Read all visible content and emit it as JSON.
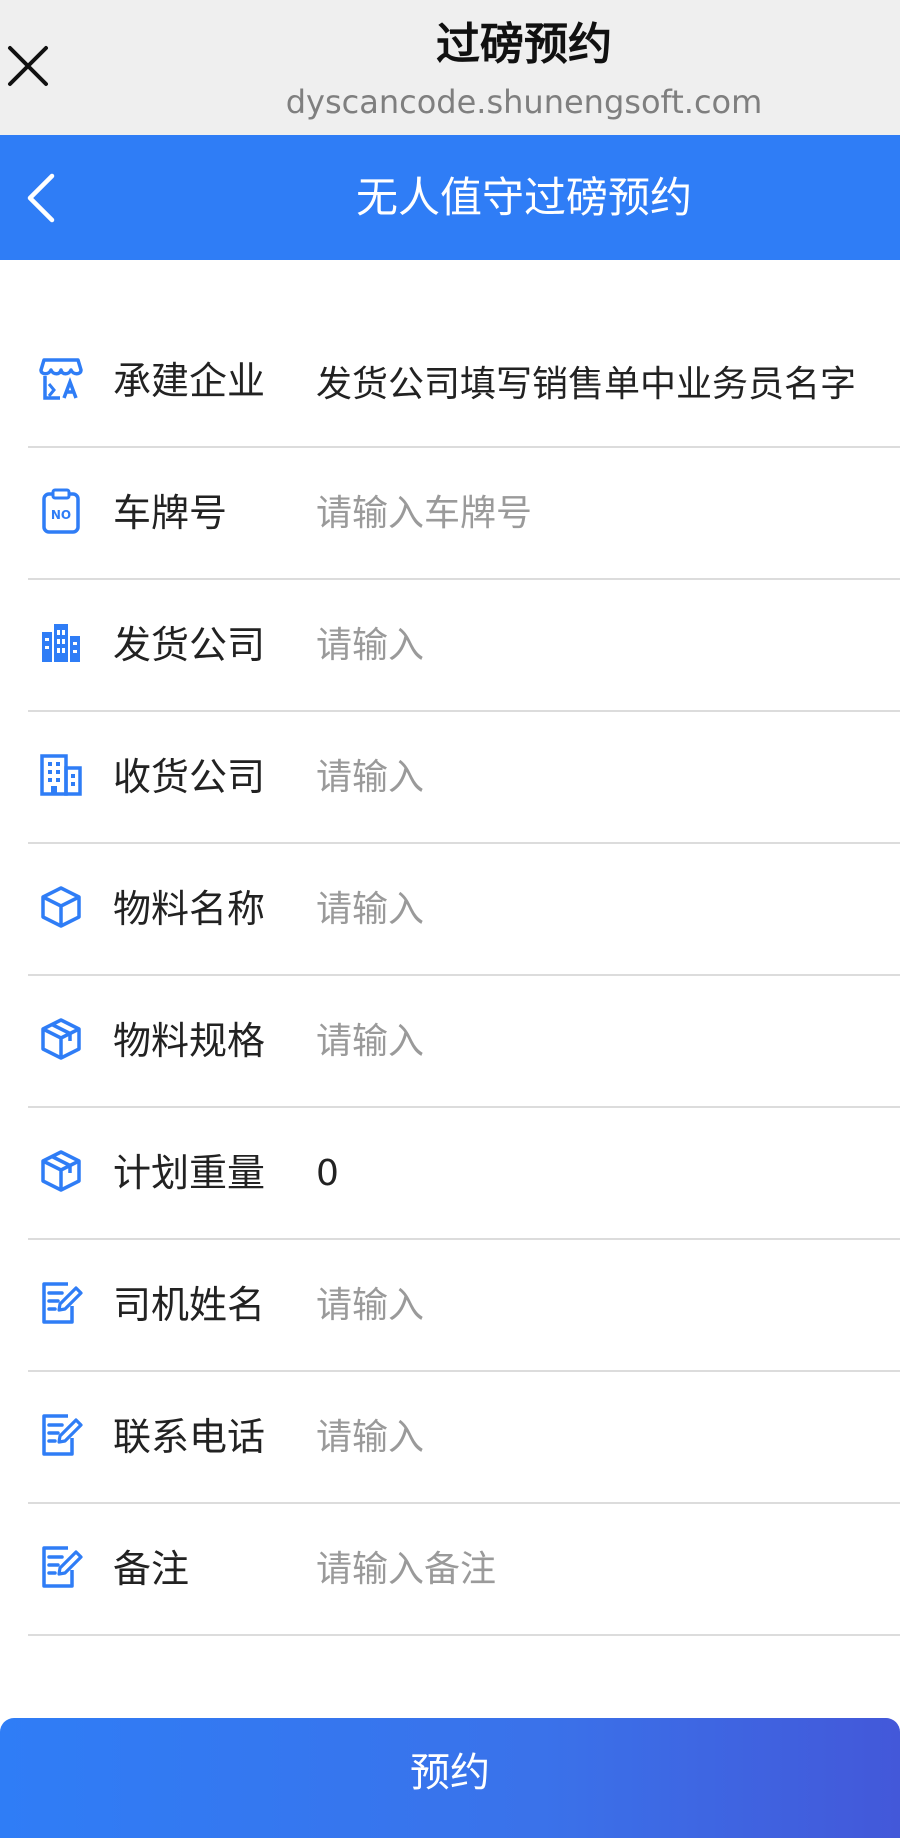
{
  "browser": {
    "title": "过磅预约",
    "url": "dyscancode.shunengsoft.com"
  },
  "header": {
    "title": "无人值守过磅预约"
  },
  "form": {
    "fields": [
      {
        "label": "承建企业",
        "value": "发货公司填写销售单中业务员名字",
        "placeholder": "",
        "icon": "store-icon"
      },
      {
        "label": "车牌号",
        "value": "",
        "placeholder": "请输入车牌号",
        "icon": "license-plate-icon"
      },
      {
        "label": "发货公司",
        "value": "",
        "placeholder": "请输入",
        "icon": "building-icon"
      },
      {
        "label": "收货公司",
        "value": "",
        "placeholder": "请输入",
        "icon": "office-building-icon"
      },
      {
        "label": "物料名称",
        "value": "",
        "placeholder": "请输入",
        "icon": "cube-icon"
      },
      {
        "label": "物料规格",
        "value": "",
        "placeholder": "请输入",
        "icon": "package-icon"
      },
      {
        "label": "计划重量",
        "value": "0",
        "placeholder": "",
        "icon": "package-icon"
      },
      {
        "label": "司机姓名",
        "value": "",
        "placeholder": "请输入",
        "icon": "edit-note-icon"
      },
      {
        "label": "联系电话",
        "value": "",
        "placeholder": "请输入",
        "icon": "edit-note-icon"
      },
      {
        "label": "备注",
        "value": "",
        "placeholder": "请输入备注",
        "icon": "edit-note-icon"
      }
    ]
  },
  "submit_label": "预约",
  "colors": {
    "accent": "#2f7df6",
    "icon": "#2f7df6",
    "divider": "#dcdcdc"
  }
}
